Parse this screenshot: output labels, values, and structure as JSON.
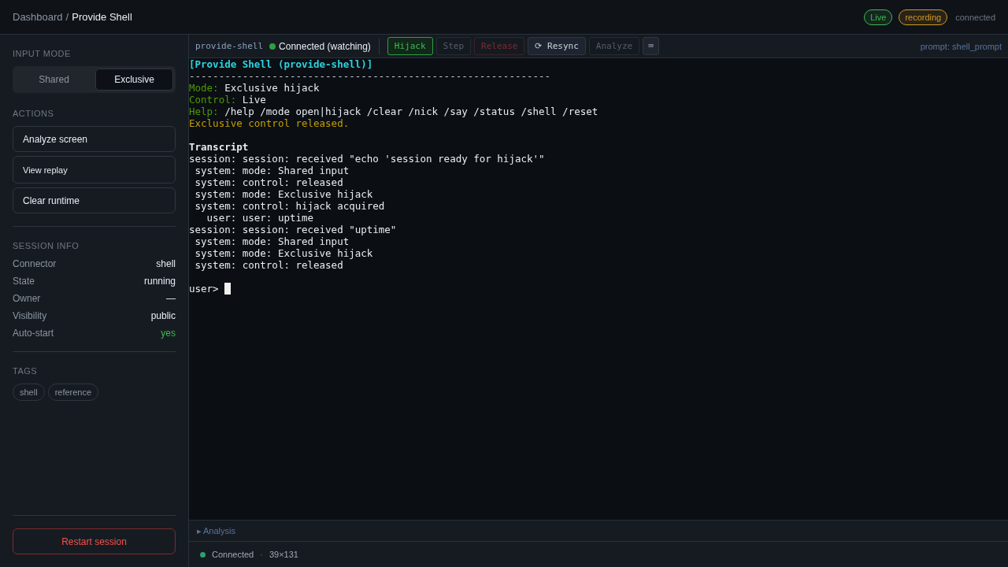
{
  "breadcrumb": {
    "parent": "Dashboard",
    "separator": "/",
    "current": "Provide Shell"
  },
  "header_badges": [
    {
      "label": "Live",
      "color": "#3fb950"
    },
    {
      "label": "recording",
      "color": "#d29922"
    }
  ],
  "connection_text": "connected",
  "sidebar": {
    "input_mode": {
      "title": "INPUT MODE",
      "options": [
        {
          "label": "Shared",
          "selected": false
        },
        {
          "label": "Exclusive",
          "selected": true
        }
      ]
    },
    "actions": {
      "title": "ACTIONS",
      "buttons": [
        "Analyze screen",
        "View replay",
        "Clear runtime"
      ]
    },
    "session_info": {
      "title": "SESSION INFO",
      "rows": [
        {
          "label": "Connector",
          "value": "shell",
          "positive": false
        },
        {
          "label": "State",
          "value": "running",
          "positive": false
        },
        {
          "label": "Owner",
          "value": "—",
          "positive": false
        },
        {
          "label": "Visibility",
          "value": "public",
          "positive": false
        },
        {
          "label": "Auto-start",
          "value": "yes",
          "positive": true
        }
      ]
    },
    "tags": {
      "title": "TAGS",
      "items": [
        "shell",
        "reference"
      ]
    },
    "restart_button": "Restart session"
  },
  "toolbar": {
    "session_id": "provide-shell",
    "status": "Connected (watching)",
    "buttons": [
      {
        "label": "Hijack",
        "kind": "primary"
      },
      {
        "label": "Step",
        "kind": "disabled"
      },
      {
        "label": "Release",
        "kind": "danger"
      },
      {
        "label": "⟳ Resync",
        "kind": "default"
      },
      {
        "label": "Analyze",
        "kind": "disabled"
      },
      {
        "label": "⌨",
        "kind": "icon"
      }
    ],
    "prompt": "prompt: shell_prompt"
  },
  "terminal": {
    "lines": [
      {
        "kind": "title",
        "text": "[Provide Shell (provide-shell)]"
      },
      {
        "kind": "rule",
        "text": "-------------------------------------------------------------"
      },
      {
        "kind": "field",
        "label": "Mode:",
        "text": "Exclusive hijack"
      },
      {
        "kind": "field",
        "label": "Control:",
        "text": "Live"
      },
      {
        "kind": "field",
        "label": "Help:",
        "text": "/help /mode open|hijack /clear /nick /say /status /shell /reset"
      },
      {
        "kind": "notice",
        "text": "Exclusive control released."
      },
      {
        "kind": "blank"
      },
      {
        "kind": "heading",
        "text": "Transcript"
      },
      {
        "kind": "plain",
        "text": "session: session: received \"echo 'session ready for hijack'\""
      },
      {
        "kind": "plain",
        "text": " system: mode: Shared input"
      },
      {
        "kind": "plain",
        "text": " system: control: released"
      },
      {
        "kind": "plain",
        "text": " system: mode: Exclusive hijack"
      },
      {
        "kind": "plain",
        "text": " system: control: hijack acquired"
      },
      {
        "kind": "plain",
        "text": "   user: user: uptime"
      },
      {
        "kind": "plain",
        "text": "session: session: received \"uptime\""
      },
      {
        "kind": "plain",
        "text": " system: mode: Shared input"
      },
      {
        "kind": "plain",
        "text": " system: mode: Exclusive hijack"
      },
      {
        "kind": "plain",
        "text": " system: control: released"
      },
      {
        "kind": "blank"
      },
      {
        "kind": "prompt",
        "text": "user> "
      }
    ]
  },
  "analysis_toggle": "▸ Analysis",
  "status_bar": {
    "status": "Connected",
    "separator": "·",
    "size": "39×131"
  }
}
